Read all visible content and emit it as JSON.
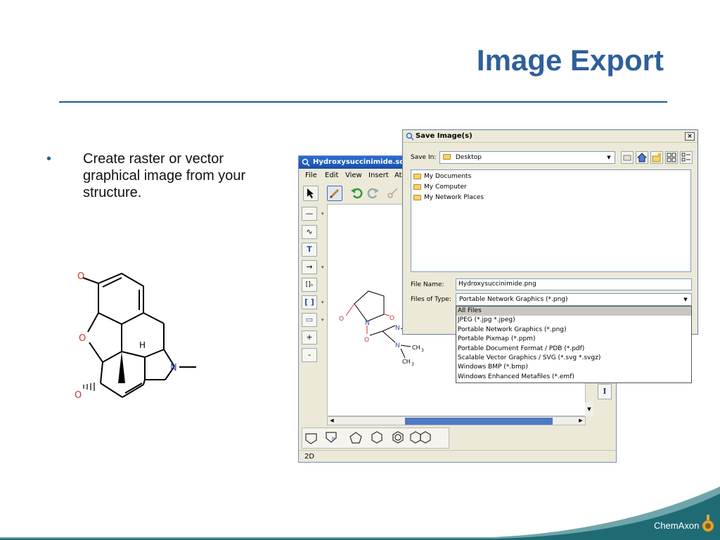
{
  "slide": {
    "title": "Image Export",
    "bullet_symbol": "•",
    "bullet_text": "Create raster or vector graphical image from your structure."
  },
  "molecule": {
    "atoms": {
      "o1": "O",
      "o2": "O",
      "o3": "O",
      "n": "N",
      "h": "H"
    }
  },
  "editor": {
    "title": "Hydroxysuccinimide.sdf - M",
    "menu": [
      "File",
      "Edit",
      "View",
      "Insert",
      "At"
    ],
    "side_tools": [
      "—",
      "∿",
      "T",
      "→",
      "[]ₙ",
      "[ ]",
      "▭",
      "+",
      "-"
    ],
    "isotope_button": "I",
    "status": "2D",
    "structure": {
      "o_left": "O",
      "o_right": "O",
      "n_ring": "N",
      "o_link": "O",
      "n_upper": "N",
      "n_lower": "N",
      "ch3_a": "CH",
      "ch3_b": "CH",
      "ch3_c": "CH",
      "sub3": "3",
      "n_template": "N"
    }
  },
  "dialog": {
    "title": "Save Image(s)",
    "close": "×",
    "save_in_label": "Save In:",
    "save_in_value": "Desktop",
    "files": [
      "My Documents",
      "My Computer",
      "My Network Places"
    ],
    "file_name_label": "File Name:",
    "file_name_value": "Hydroxysuccinimide.png",
    "files_of_type_label": "Files of Type:",
    "files_of_type_value": "Portable Network Graphics (*.png)",
    "type_options": [
      "All Files",
      "JPEG (*.jpg *.jpeg)",
      "Portable Network Graphics (*.png)",
      "Portable Pixmap (*.ppm)",
      "Portable Document Format / PDB (*.pdf)",
      "Scalable Vector Graphics / SVG (*.svg *.svgz)",
      "Windows BMP (*.bmp)",
      "Windows Enhanced Metafiles (*.emf)"
    ]
  },
  "footer": {
    "brand": "ChemAxon"
  },
  "colors": {
    "title": "#2f5f9a",
    "accent": "#1d5b94",
    "footer_teal": "#1f6b74"
  }
}
